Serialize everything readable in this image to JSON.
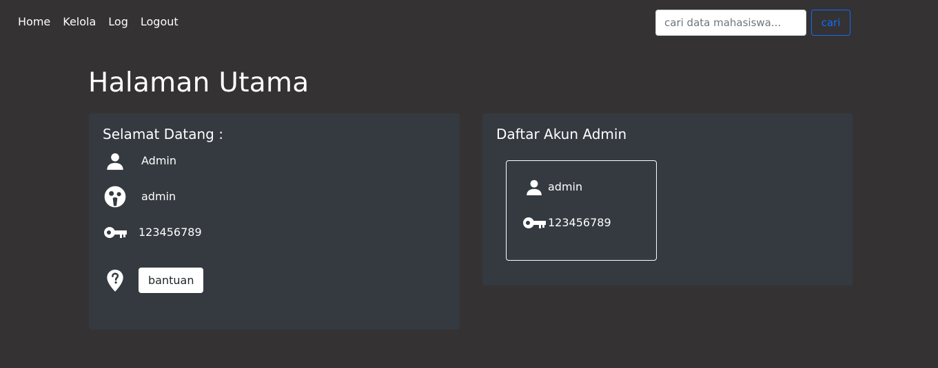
{
  "nav": {
    "links": [
      "Home",
      "Kelola",
      "Log",
      "Logout"
    ]
  },
  "search": {
    "placeholder": "cari data mahasiswa...",
    "button_label": "cari"
  },
  "page_title": "Halaman Utama",
  "welcome_card": {
    "heading": "Selamat Datang :",
    "name": "Admin",
    "username": "admin",
    "password": "123456789",
    "help_label": "bantuan"
  },
  "admin_list_card": {
    "heading": "Daftar Akun Admin",
    "accounts": [
      {
        "username": "admin",
        "password": "123456789"
      }
    ]
  },
  "colors": {
    "background": "#353233",
    "card": "#343a40",
    "primary": "#0d6efd"
  },
  "icons": [
    "user-icon",
    "user-circle-icon",
    "key-icon",
    "location-question-icon"
  ]
}
